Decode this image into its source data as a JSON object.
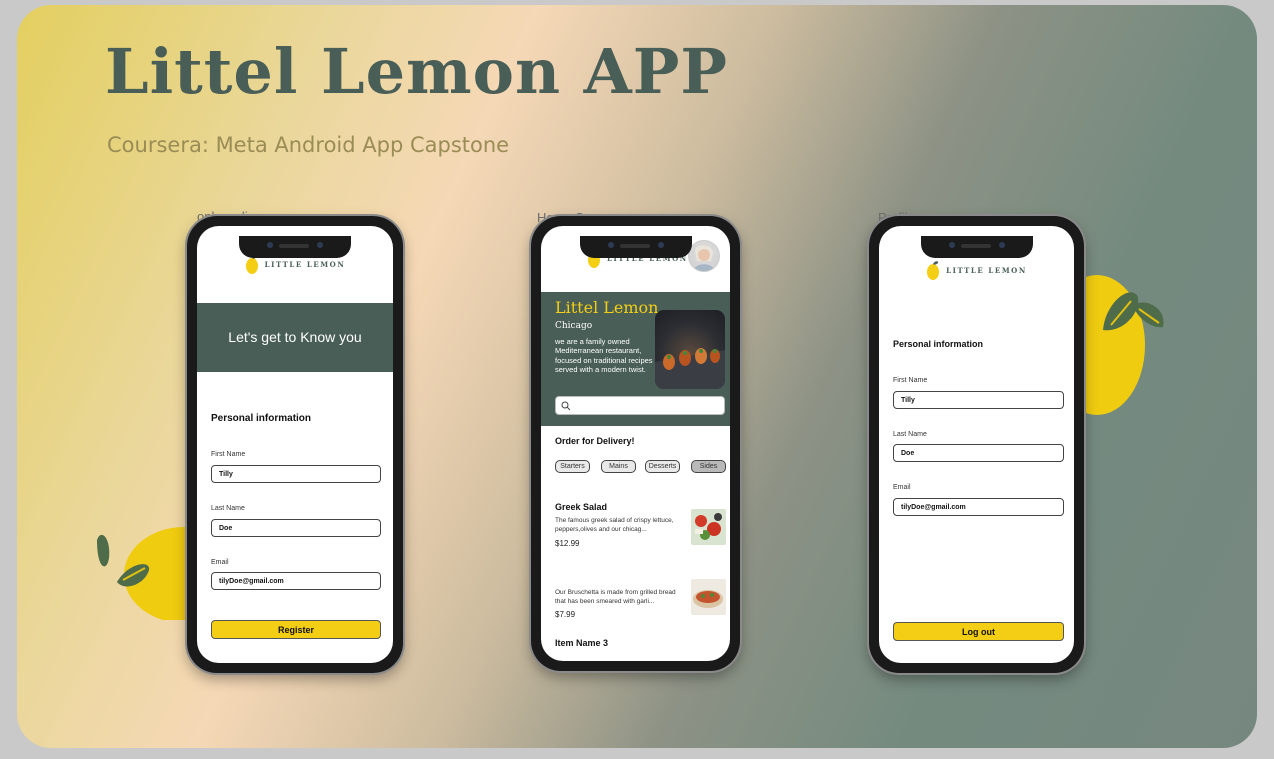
{
  "header": {
    "title": "Littel Lemon APP",
    "subtitle": "Coursera: Meta Android App Capstone"
  },
  "frames": {
    "onboarding": "onboarding",
    "home": "Home Screen",
    "profile": "Profile"
  },
  "brand": {
    "logo_text": "LITTLE LEMON"
  },
  "onboarding": {
    "banner": "Let's get to Know you",
    "section_title": "Personal information",
    "first_name_label": "First Name",
    "first_name_value": "Tilly",
    "last_name_label": "Last Name",
    "last_name_value": "Doe",
    "email_label": "Email",
    "email_value": "tilyDoe@gmail.com",
    "register_label": "Register"
  },
  "home": {
    "hero_title": "Littel Lemon",
    "hero_city": "Chicago",
    "hero_desc": "we are a family owned Mediterranean restaurant, focused on traditional recipes served with a modern twist.",
    "order_title": "Order for Delivery!",
    "categories": [
      "Starters",
      "Mains",
      "Desserts",
      "Sides"
    ],
    "active_category": "Sides",
    "items": [
      {
        "name": "Greek Salad",
        "desc": "The famous greek salad of crispy lettuce, peppers,olives and our chicag...",
        "price": "$12.99"
      },
      {
        "name": "",
        "desc": "Our Bruschetta is made from grilled bread that has been smeared with garli...",
        "price": "$7.99"
      },
      {
        "name": "Item Name 3",
        "desc": "",
        "price": ""
      }
    ]
  },
  "profile": {
    "section_title": "Personal information",
    "first_name_label": "First Name",
    "first_name_value": "Tilly",
    "last_name_label": "Last Name",
    "last_name_value": "Doe",
    "email_label": "Email",
    "email_value": "tilyDoe@gmail.com",
    "logout_label": "Log out"
  },
  "colors": {
    "brand_green": "#495e57",
    "brand_yellow": "#f4ce14"
  }
}
